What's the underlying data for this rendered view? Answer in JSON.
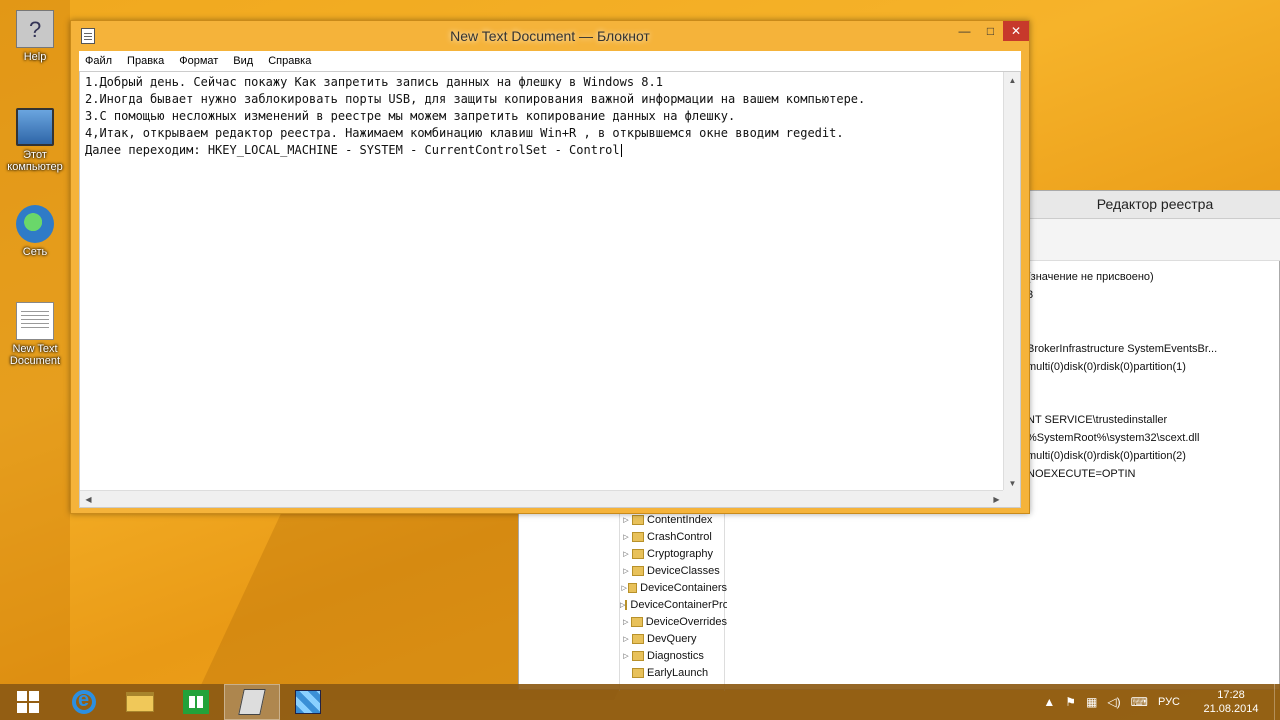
{
  "desktop": {
    "icons": [
      {
        "label": "Help"
      },
      {
        "label": "Этот компьютер"
      },
      {
        "label": "Сеть"
      },
      {
        "label": "New Text Document"
      }
    ]
  },
  "regedit": {
    "title": "Редактор реестра",
    "values": [
      "(значение не присвоено)",
      "3",
      "BrokerInfrastructure SystemEventsBr...",
      "multi(0)disk(0)rdisk(0)partition(1)",
      "NT SERVICE\\trustedinstaller",
      "%SystemRoot%\\system32\\scext.dll",
      "multi(0)disk(0)rdisk(0)partition(2)",
      "NOEXECUTE=OPTIN"
    ],
    "tree": [
      {
        "label": "ContentIndex",
        "arrow": "▷"
      },
      {
        "label": "CrashControl",
        "arrow": "▷"
      },
      {
        "label": "Cryptography",
        "arrow": "▷"
      },
      {
        "label": "DeviceClasses",
        "arrow": "▷"
      },
      {
        "label": "DeviceContainers",
        "arrow": "▷"
      },
      {
        "label": "DeviceContainerPropertyUpdateEvents",
        "arrow": "▷"
      },
      {
        "label": "DeviceOverrides",
        "arrow": "▷"
      },
      {
        "label": "DevQuery",
        "arrow": "▷"
      },
      {
        "label": "Diagnostics",
        "arrow": "▷"
      },
      {
        "label": "EarlyLaunch",
        "arrow": ""
      }
    ]
  },
  "notepad": {
    "title": "New Text Document — Блокнот",
    "min_glyph": "—",
    "max_glyph": "□",
    "close_glyph": "✕",
    "menu": [
      "Файл",
      "Правка",
      "Формат",
      "Вид",
      "Справка"
    ],
    "lines": [
      "1.Добрый день. Сейчас покажу Как запретить запись данных на флешку в Windows 8.1",
      "2.Иногда бывает нужно заблокировать порты USB, для защиты копирования важной информации на вашем компьютере.",
      "3.С помощью несложных изменений в реестре мы можем запретить копирование данных на флешку.",
      "4,Итак, открываем редактор реестра. Нажимаем комбинацию клавиш Win+R , в открывшемся окне вводим regedit.",
      "Далее переходим: HKEY_LOCAL_MACHINE - SYSTEM - CurrentControlSet - Control"
    ],
    "scroll_up": "▲",
    "scroll_down": "▼",
    "scroll_left": "◀",
    "scroll_right": "▶"
  },
  "taskbar": {
    "tray_icons": [
      "flag-icon",
      "network-icon",
      "volume-icon",
      "keyboard-icon"
    ],
    "tray_glyphs": [
      "▲",
      "⚑",
      "▦",
      "◁)",
      "⌨"
    ],
    "language": "РУС",
    "time": "17:28",
    "date": "21.08.2014"
  }
}
